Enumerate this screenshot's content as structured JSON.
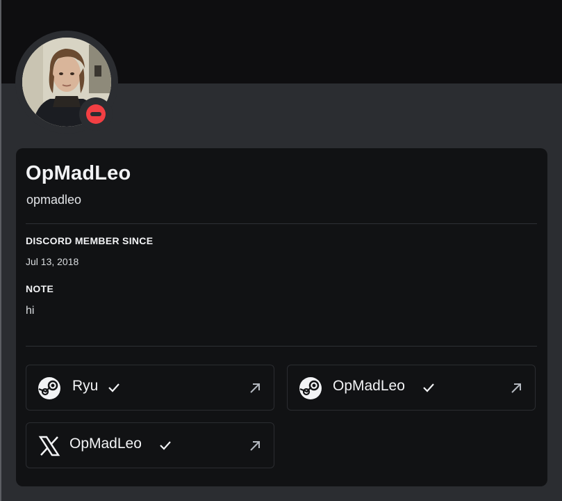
{
  "profile": {
    "display_name": "OpMadLeo",
    "username": "opmadleo",
    "status": "do-not-disturb",
    "status_color": "#f23f43"
  },
  "sections": {
    "member_since_title": "DISCORD MEMBER SINCE",
    "member_since_value": "Jul 13, 2018",
    "note_title": "NOTE",
    "note_value": "hi"
  },
  "connections": [
    {
      "service": "steam",
      "icon": "steam-icon",
      "name": "Ryu",
      "verified": true
    },
    {
      "service": "steam",
      "icon": "steam-icon",
      "name": "OpMadLeo",
      "verified": true
    },
    {
      "service": "x",
      "icon": "x-logo-icon",
      "name": "OpMadLeo",
      "verified": true
    }
  ],
  "colors": {
    "background": "#2b2d31",
    "banner": "#0e0e10",
    "card": "#111214",
    "status_dnd": "#f23f43"
  }
}
